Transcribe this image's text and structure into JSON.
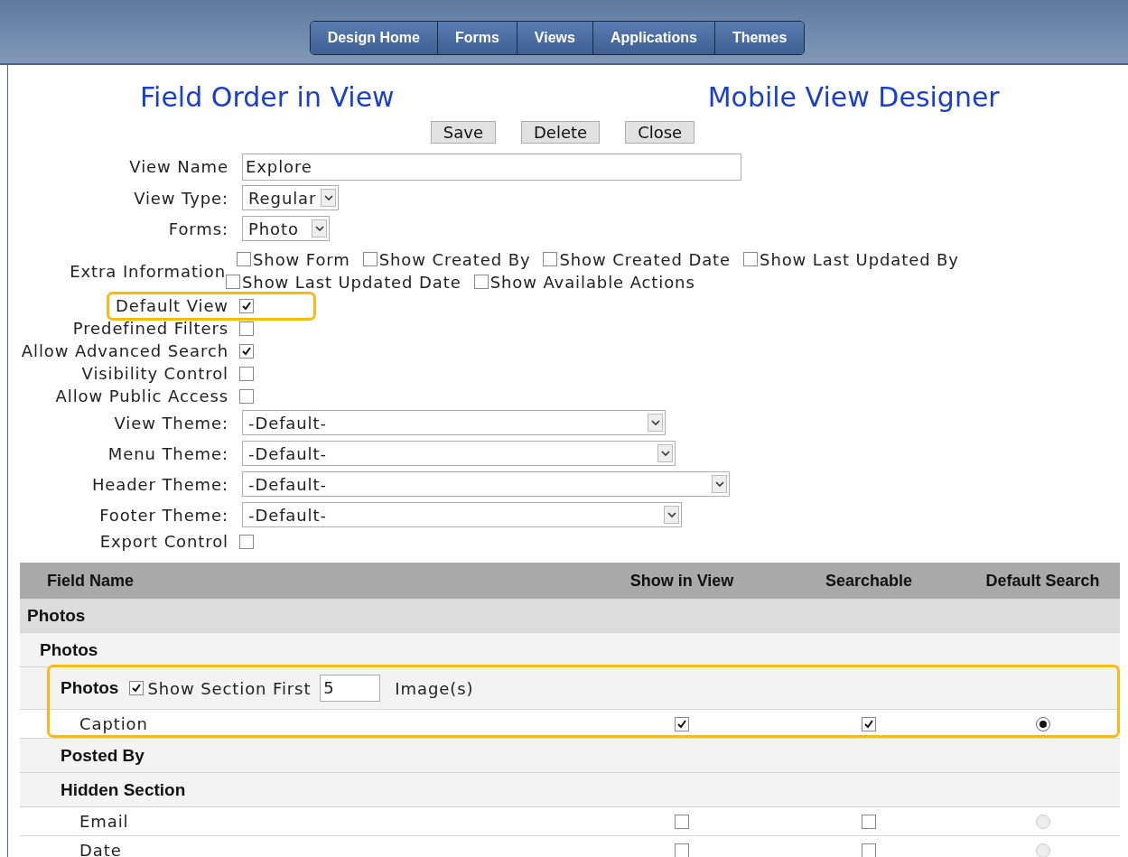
{
  "nav": [
    "Design Home",
    "Forms",
    "Views",
    "Applications",
    "Themes"
  ],
  "titles": [
    "Field Order in View",
    "Mobile View Designer"
  ],
  "actions": [
    "Save",
    "Delete",
    "Close"
  ],
  "form": [
    {
      "kind": "text",
      "label": "View Name",
      "value": "Explore",
      "highlighted": false
    },
    {
      "kind": "select",
      "label": "View Type:",
      "value": "Regular",
      "highlighted": false
    },
    {
      "kind": "select",
      "label": "Forms:",
      "value": "Photo",
      "highlighted": false
    },
    {
      "kind": "options",
      "label": "Extra Information",
      "highlighted": false,
      "options": [
        {
          "label": "Show Form",
          "checked": false
        },
        {
          "label": "Show Created By",
          "checked": false
        },
        {
          "label": "Show Created Date",
          "checked": false
        },
        {
          "label": "Show Last Updated By",
          "checked": false
        },
        {
          "label": "Show Last Updated Date",
          "checked": false
        },
        {
          "label": "Show Available Actions",
          "checked": false
        }
      ]
    },
    {
      "kind": "checkbox",
      "label": "Default View",
      "checked": true,
      "highlighted": true
    },
    {
      "kind": "checkbox",
      "label": "Predefined Filters",
      "checked": false,
      "highlighted": false
    },
    {
      "kind": "checkbox",
      "label": "Allow Advanced Search",
      "checked": true,
      "highlighted": false
    },
    {
      "kind": "checkbox",
      "label": "Visibility Control",
      "checked": false,
      "highlighted": false
    },
    {
      "kind": "checkbox",
      "label": "Allow Public Access",
      "checked": false,
      "highlighted": false
    },
    {
      "kind": "select",
      "label": "View Theme:",
      "value": "-Default-",
      "highlighted": false
    },
    {
      "kind": "select",
      "label": "Menu Theme:",
      "value": "-Default-",
      "highlighted": false
    },
    {
      "kind": "select",
      "label": "Header Theme:",
      "value": "-Default-",
      "highlighted": false
    },
    {
      "kind": "select",
      "label": "Footer Theme:",
      "value": "-Default-",
      "highlighted": false
    },
    {
      "kind": "checkbox",
      "label": "Export Control",
      "checked": false,
      "highlighted": false
    }
  ],
  "table": {
    "columns": [
      "Field Name",
      "Show in View",
      "Searchable",
      "Default Search"
    ],
    "rows": [
      {
        "kind": "group",
        "name": "Photos",
        "highlighted": false,
        "children": [
          {
            "kind": "group",
            "name": "Photos",
            "highlighted": false,
            "children": [
              {
                "kind": "section",
                "name": "Photos",
                "highlighted": true,
                "show_first": {
                  "label": "Show Section First",
                  "checked": true,
                  "value": "5",
                  "suffix": "Image(s)"
                },
                "children": [
                  {
                    "kind": "field",
                    "name": "Caption",
                    "highlighted": false,
                    "show_in_view": true,
                    "searchable": true,
                    "default_search": {
                      "selected": true,
                      "disabled": false
                    }
                  }
                ]
              },
              {
                "kind": "section",
                "name": "Posted By",
                "highlighted": false
              },
              {
                "kind": "section",
                "name": "Hidden Section",
                "highlighted": false,
                "children": [
                  {
                    "kind": "field",
                    "name": "Email",
                    "highlighted": false,
                    "show_in_view": false,
                    "searchable": false,
                    "default_search": {
                      "selected": false,
                      "disabled": true
                    }
                  },
                  {
                    "kind": "field",
                    "name": "Date",
                    "highlighted": false,
                    "show_in_view": false,
                    "searchable": false,
                    "default_search": {
                      "selected": false,
                      "disabled": true
                    }
                  }
                ]
              }
            ]
          }
        ]
      }
    ]
  }
}
